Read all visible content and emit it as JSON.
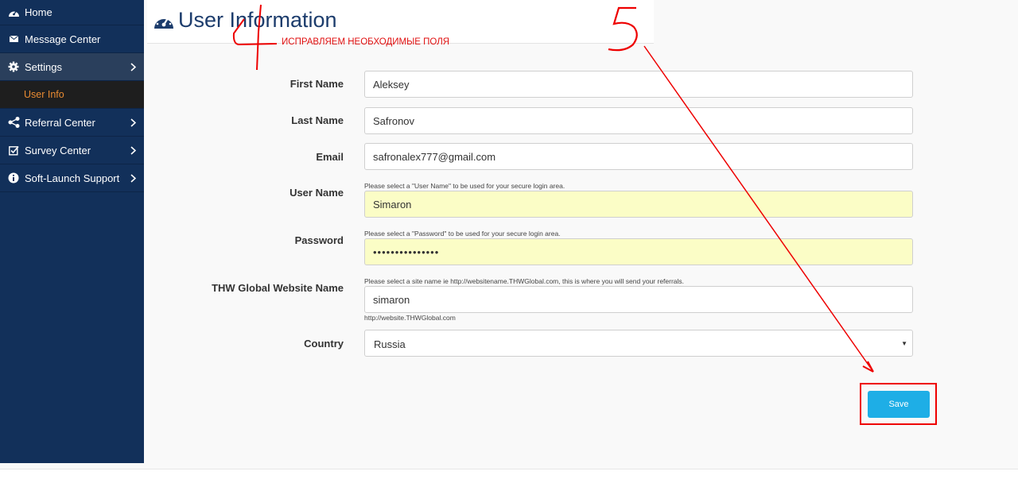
{
  "sidebar": {
    "items": [
      {
        "label": "Home",
        "icon": "dashboard-icon"
      },
      {
        "label": "Message Center",
        "icon": "envelope-icon"
      },
      {
        "label": "Settings",
        "icon": "gear-icon"
      },
      {
        "label": "User Info",
        "icon": ""
      },
      {
        "label": "Referral Center",
        "icon": "share-icon"
      },
      {
        "label": "Survey Center",
        "icon": "checkbox-icon"
      },
      {
        "label": "Soft-Launch Support",
        "icon": "info-icon"
      }
    ]
  },
  "header": {
    "title": "User Information"
  },
  "annotations": {
    "note": "ИСПРАВЛЯЕМ НЕОБХОДИМЫЕ ПОЛЯ",
    "step4": "4",
    "step5": "5"
  },
  "form": {
    "first_name": {
      "label": "First Name",
      "value": "Aleksey"
    },
    "last_name": {
      "label": "Last Name",
      "value": "Safronov"
    },
    "email": {
      "label": "Email",
      "value": "safronalex777@gmail.com"
    },
    "user_name": {
      "label": "User Name",
      "hint": "Please select a \"User Name\" to be used for your secure login area.",
      "value": "Simaron"
    },
    "password": {
      "label": "Password",
      "hint": "Please select a \"Password\" to be used for your secure login area.",
      "value": "•••••••••••••••"
    },
    "website": {
      "label": "THW Global Website Name",
      "hint": "Please select a site name ie http://websitename.THWGlobal.com, this is where you will send your referrals.",
      "value": "simaron",
      "sub_hint": "http://website.THWGlobal.com"
    },
    "country": {
      "label": "Country",
      "value": "Russia"
    },
    "save_label": "Save"
  },
  "colors": {
    "sidebar": "#12305a",
    "accent": "#1eaee6",
    "highlight": "#fbfdc6",
    "active_sub": "#e98b32",
    "annotation": "#e01010"
  }
}
